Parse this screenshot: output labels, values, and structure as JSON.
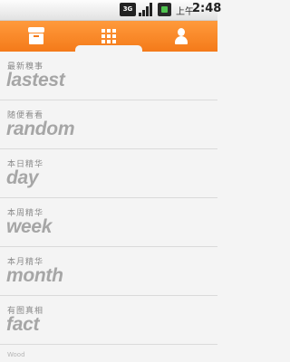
{
  "status_bar": {
    "network": "3G",
    "ampm": "上午",
    "time": "2:48",
    "icons": [
      "3g-icon",
      "signal-icon",
      "battery-icon"
    ]
  },
  "tabs": [
    {
      "name": "home",
      "icon": "box-icon",
      "active": false
    },
    {
      "name": "categories",
      "icon": "grid-icon",
      "active": true
    },
    {
      "name": "profile",
      "icon": "user-icon",
      "active": false
    }
  ],
  "list": [
    {
      "cn": "最新糗事",
      "en": "lastest"
    },
    {
      "cn": "随便看看",
      "en": "random"
    },
    {
      "cn": "本日精华",
      "en": "day"
    },
    {
      "cn": "本周精华",
      "en": "week"
    },
    {
      "cn": "本月精华",
      "en": "month"
    },
    {
      "cn": "有图真相",
      "en": "fact"
    }
  ],
  "footer": {
    "text": "Wood"
  },
  "colors": {
    "accent": "#f47a1a",
    "background": "#f4f4f4",
    "item_text": "#a6a6a6"
  }
}
